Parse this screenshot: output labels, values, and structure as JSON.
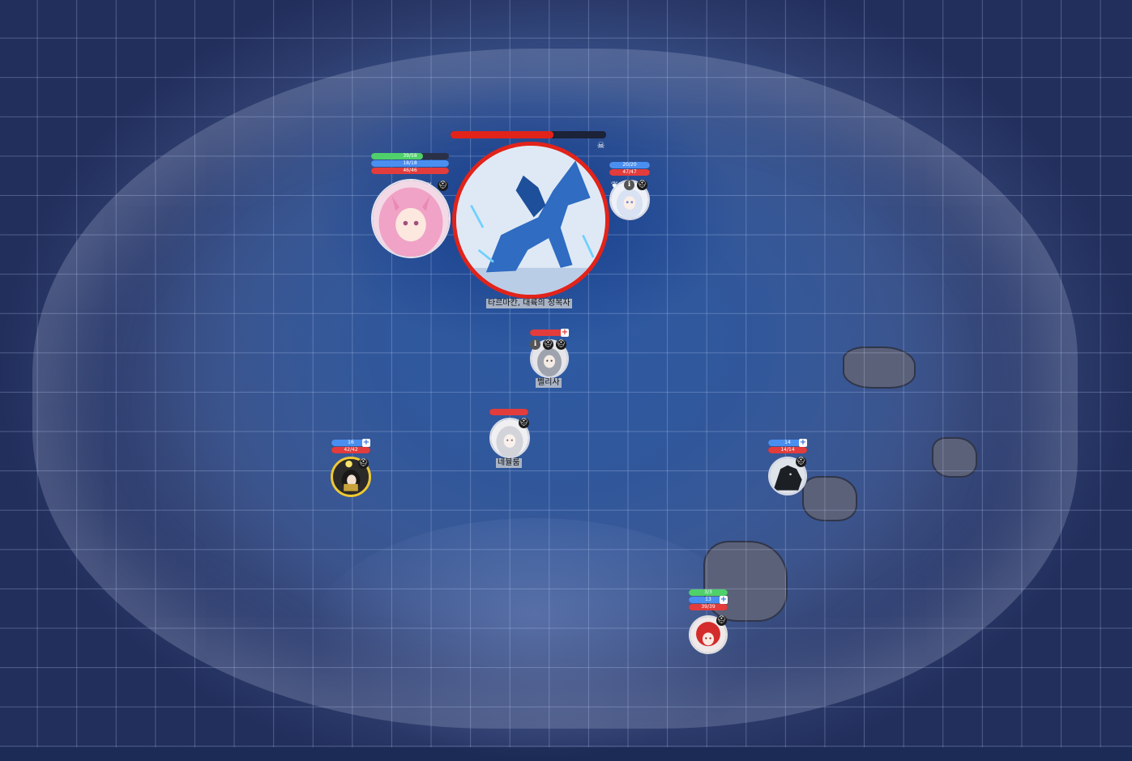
{
  "map": {
    "name": "",
    "colors": {
      "ice": "#2d5aa3",
      "edge": "#222f5d",
      "grid": "rgba(200,215,255,0.28)"
    }
  },
  "tokens": [
    {
      "id": "dragon",
      "name_label": "타르마칸, 대륙의 정복자",
      "border_color": "#e2231a",
      "hp_fraction": 0.66,
      "bars": [],
      "status_icons": [
        "skull-icon"
      ]
    },
    {
      "id": "pink-hero",
      "name_label": "",
      "border_color": "#e4e4ee",
      "bars": [
        {
          "text": "39/58",
          "color": "#4fd06a",
          "fraction": 0.67
        },
        {
          "text": "18/18",
          "color": "#4a8ff0",
          "fraction": 1.0
        },
        {
          "text": "46/46",
          "color": "#e23c3c",
          "fraction": 1.0
        }
      ],
      "status_icons": [
        "paw-icon",
        "cross-icon",
        "wing-icon",
        "mask-icon"
      ]
    },
    {
      "id": "white-fox",
      "name_label": "",
      "border_color": "#d8dbe6",
      "bars": [
        {
          "text": "20/20",
          "color": "#4a8ff0",
          "fraction": 1.0
        },
        {
          "text": "47/47",
          "color": "#e23c3c",
          "fraction": 1.0
        }
      ],
      "status_icons": [
        "wing-icon",
        "info-icon",
        "mask-icon"
      ]
    },
    {
      "id": "bellisa",
      "name_label": "벨리사",
      "border_color": "#d8dbe6",
      "bars": [
        {
          "text": "",
          "color": "#e23c3c",
          "fraction": 1.0
        }
      ],
      "status_icons": [
        "info-icon",
        "mask-icon",
        "mask-icon"
      ],
      "badge": "+"
    },
    {
      "id": "nebulum",
      "name_label": "네뷸룸",
      "border_color": "#d8dbe6",
      "bars": [
        {
          "text": "",
          "color": "#e23c3c",
          "fraction": 1.0
        }
      ],
      "status_icons": [
        "mask-icon"
      ]
    },
    {
      "id": "gold-warrior",
      "name_label": "",
      "border_color": "#f0c830",
      "bars": [
        {
          "text": "16",
          "color": "#4a8ff0",
          "fraction": 1.0
        },
        {
          "text": "42/42",
          "color": "#e23c3c",
          "fraction": 1.0
        }
      ],
      "status_icons": [
        "sun-icon",
        "mask-icon"
      ],
      "badge": "+"
    },
    {
      "id": "dark-beast",
      "name_label": "",
      "border_color": "#d8dbe6",
      "bars": [
        {
          "text": "14",
          "color": "#4a8ff0",
          "fraction": 1.0
        },
        {
          "text": "14/14",
          "color": "#e23c3c",
          "fraction": 1.0
        }
      ],
      "status_icons": [
        "mask-icon"
      ],
      "badge": "+"
    },
    {
      "id": "red-hair",
      "name_label": "",
      "border_color": "#e0e0e0",
      "bars": [
        {
          "text": "3/3",
          "color": "#4fd06a",
          "fraction": 1.0
        },
        {
          "text": "13",
          "color": "#4a8ff0",
          "fraction": 1.0
        },
        {
          "text": "39/39",
          "color": "#e23c3c",
          "fraction": 1.0
        }
      ],
      "status_icons": [
        "mask-icon"
      ],
      "badge": "+"
    }
  ]
}
